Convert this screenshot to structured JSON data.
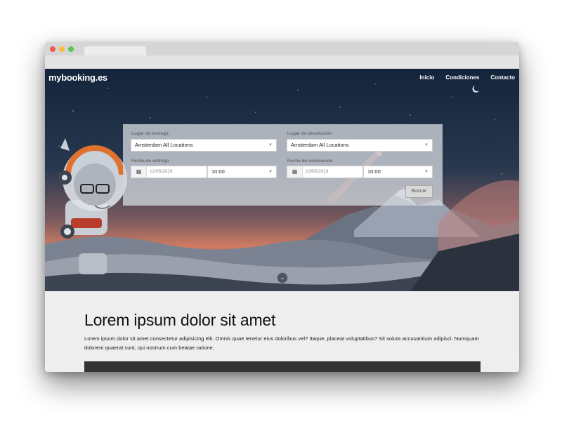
{
  "site": {
    "logo": "mybooking.es",
    "nav": [
      "Inicio",
      "Condiciones",
      "Contacto"
    ]
  },
  "form": {
    "pickup_place_label": "Lugar de entrega",
    "pickup_place_value": "Amsterdam All Locations",
    "return_place_label": "Lugar de devolución",
    "return_place_value": "Amsterdam All Locations",
    "pickup_date_label": "Fecha de entrega",
    "pickup_date_value": "12/05/2019",
    "pickup_time_value": "10:00",
    "return_date_label": "Fecha de devolución",
    "return_date_value": "13/05/2019",
    "return_time_value": "10:00",
    "search_button": "Buscar"
  },
  "content": {
    "heading": "Lorem ipsum dolor sit amet",
    "paragraph": "Lorem ipsum dolor sit amet consectetur adipisicing elit. Omnis quae tenetur eius doloribus vel? Itaque, placeat voluptatibus? Sit soluta accusantium adipisci. Numquam dolorem quaerat sunt, qui nostrum cum beatae ratione."
  },
  "icons": {
    "calendar": "calendar-icon",
    "caret": "chevron-down-icon",
    "scroll": "chevron-down-circle-icon"
  }
}
